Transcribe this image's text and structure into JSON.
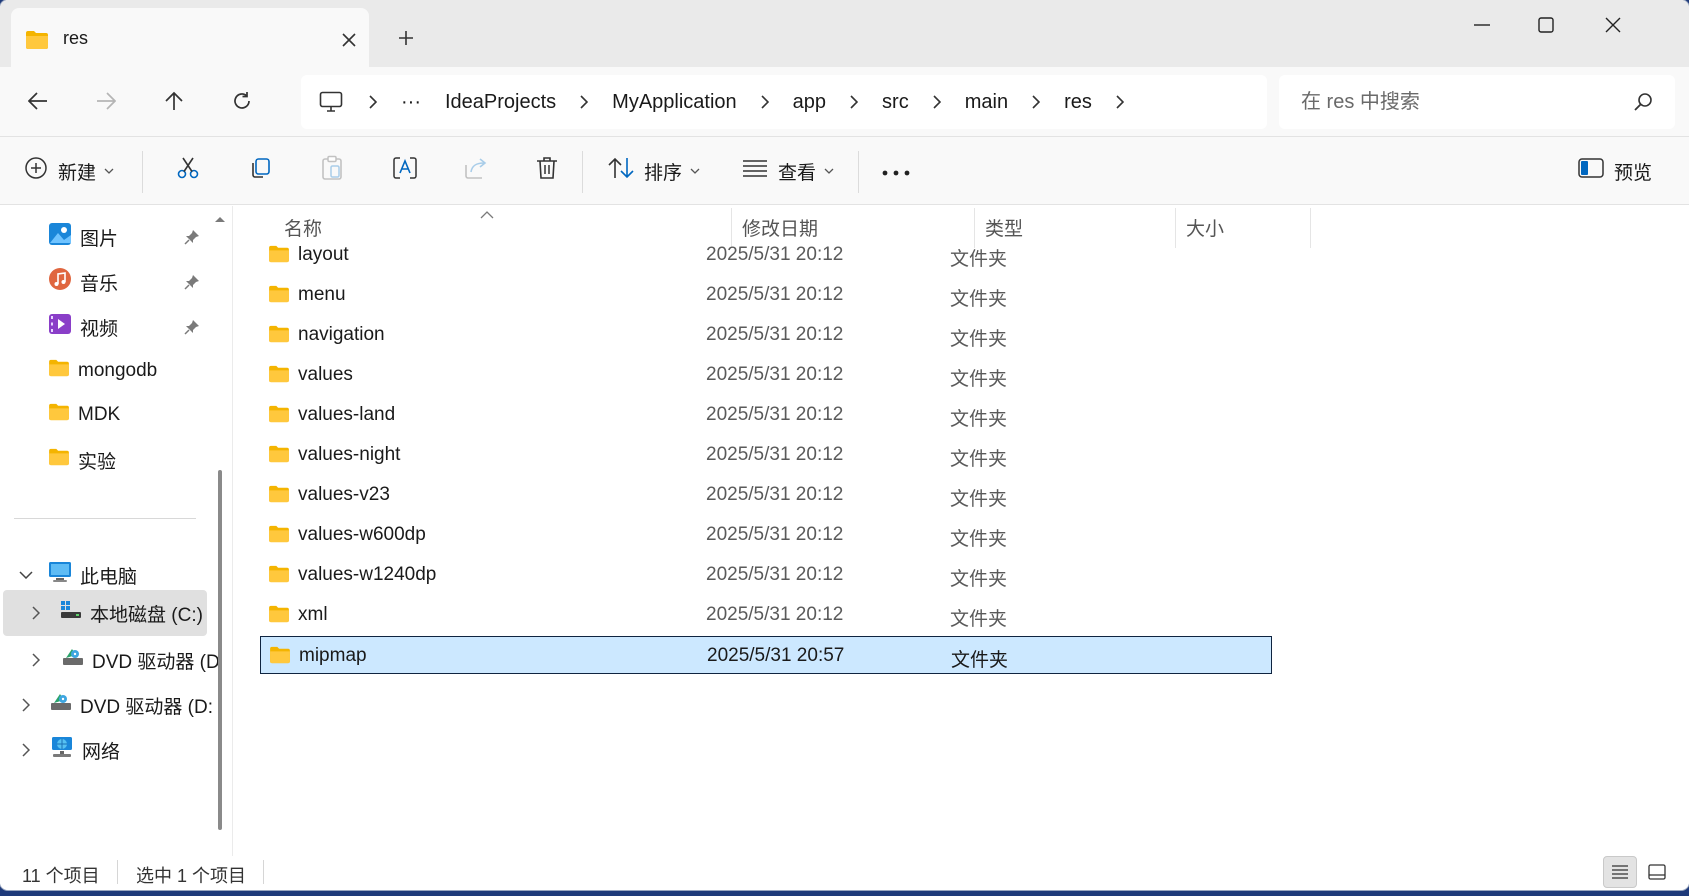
{
  "tab": {
    "title": "res"
  },
  "window": {
    "controls": [
      "minimize",
      "maximize",
      "close"
    ]
  },
  "breadcrumb": [
    "IdeaProjects",
    "MyApplication",
    "app",
    "src",
    "main",
    "res"
  ],
  "breadcrumb_overflow": "···",
  "search": {
    "placeholder": "在 res 中搜索",
    "value": ""
  },
  "toolbar": {
    "new_label": "新建",
    "sort_label": "排序",
    "view_label": "查看",
    "more_label": "···",
    "preview_label": "预览"
  },
  "sidebar": {
    "quick_access": [
      {
        "label": "图片",
        "icon": "pictures-icon",
        "pinned": true
      },
      {
        "label": "音乐",
        "icon": "music-icon",
        "pinned": true
      },
      {
        "label": "视频",
        "icon": "videos-icon",
        "pinned": true
      },
      {
        "label": "mongodb",
        "icon": "folder-icon",
        "pinned": false
      },
      {
        "label": "MDK",
        "icon": "folder-icon",
        "pinned": false
      },
      {
        "label": "实验",
        "icon": "folder-icon",
        "pinned": false
      }
    ],
    "this_pc": "此电脑",
    "local_disk": "本地磁盘 (C:)",
    "dvd_inner": "DVD 驱动器 (D",
    "dvd_outer": "DVD 驱动器 (D:",
    "network": "网络"
  },
  "columns": {
    "name": "名称",
    "date": "修改日期",
    "type": "类型",
    "size": "大小"
  },
  "files": [
    {
      "name": "layout",
      "date": "2025/5/31 20:12",
      "type": "文件夹"
    },
    {
      "name": "menu",
      "date": "2025/5/31 20:12",
      "type": "文件夹"
    },
    {
      "name": "navigation",
      "date": "2025/5/31 20:12",
      "type": "文件夹"
    },
    {
      "name": "values",
      "date": "2025/5/31 20:12",
      "type": "文件夹"
    },
    {
      "name": "values-land",
      "date": "2025/5/31 20:12",
      "type": "文件夹"
    },
    {
      "name": "values-night",
      "date": "2025/5/31 20:12",
      "type": "文件夹"
    },
    {
      "name": "values-v23",
      "date": "2025/5/31 20:12",
      "type": "文件夹"
    },
    {
      "name": "values-w600dp",
      "date": "2025/5/31 20:12",
      "type": "文件夹"
    },
    {
      "name": "values-w1240dp",
      "date": "2025/5/31 20:12",
      "type": "文件夹"
    },
    {
      "name": "xml",
      "date": "2025/5/31 20:12",
      "type": "文件夹"
    },
    {
      "name": "mipmap",
      "date": "2025/5/31 20:57",
      "type": "文件夹",
      "selected": true
    }
  ],
  "status": {
    "count": "11 个项目",
    "selected": "选中 1 个项目"
  },
  "colors": {
    "selection": "#cce8ff",
    "folder": "#ffc83d",
    "accent": "#0067c0"
  }
}
